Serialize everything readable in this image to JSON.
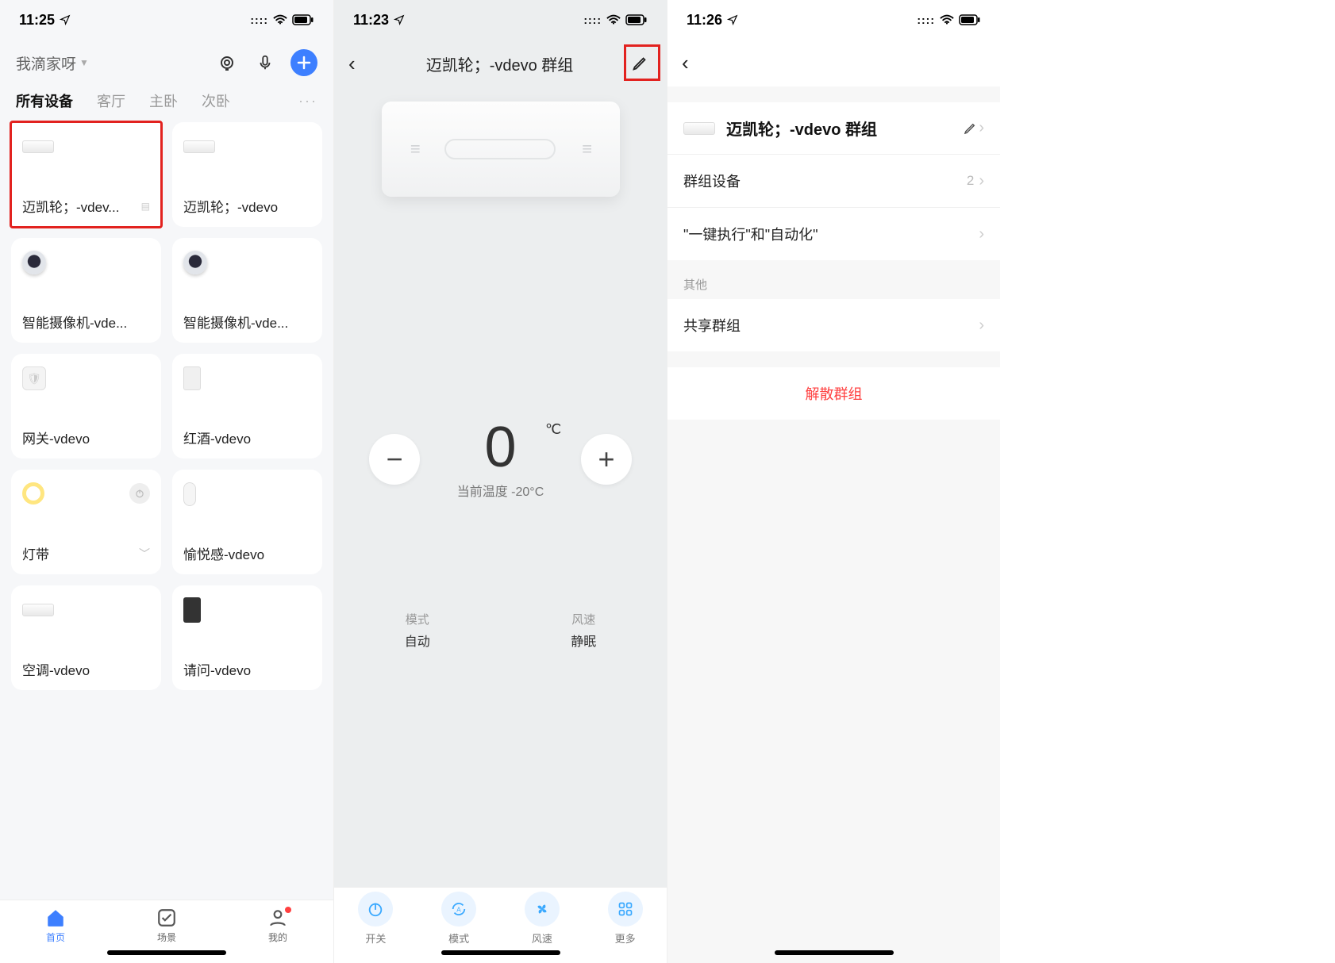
{
  "screen1": {
    "time": "11:25",
    "home": "我滴家呀",
    "tabs": {
      "all": "所有设备",
      "living": "客厅",
      "master": "主卧",
      "second": "次卧",
      "more": "···"
    },
    "devices": [
      {
        "name": "迈凯轮；-vdev..."
      },
      {
        "name": "迈凯轮；-vdevo"
      },
      {
        "name": "智能摄像机-vde..."
      },
      {
        "name": "智能摄像机-vde..."
      },
      {
        "name": "网关-vdevo"
      },
      {
        "name": "红酒-vdevo"
      },
      {
        "name": "灯带"
      },
      {
        "name": "愉悦感-vdevo"
      },
      {
        "name": "空调-vdevo"
      },
      {
        "name": "请问-vdevo"
      }
    ],
    "tabbar": {
      "home": "首页",
      "scene": "场景",
      "me": "我的"
    }
  },
  "screen2": {
    "time": "11:23",
    "title": "迈凯轮；-vdevo 群组",
    "set_temp": "0",
    "unit": "℃",
    "current_label": "当前温度 -20°C",
    "mode_lbl": "模式",
    "mode_val": "自动",
    "fan_lbl": "风速",
    "fan_val": "静眠",
    "bottom": {
      "power": "开关",
      "mode": "模式",
      "fan": "风速",
      "more": "更多"
    }
  },
  "screen3": {
    "time": "11:26",
    "group_name": "迈凯轮；-vdevo 群组",
    "rows": {
      "devices": "群组设备",
      "devices_count": "2",
      "automation": "\"一键执行\"和\"自动化\"",
      "other_section": "其他",
      "share": "共享群组",
      "dissolve": "解散群组"
    }
  }
}
